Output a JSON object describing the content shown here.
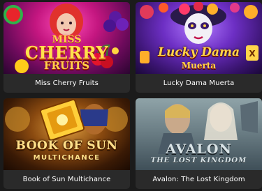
{
  "games": [
    {
      "title": "Miss Cherry Fruits",
      "logo_lines": [
        "MISS",
        "CHERRY",
        "FRUITS"
      ],
      "icon": "cherry-icon"
    },
    {
      "title": "Lucky Dama Muerta",
      "logo_lines": [
        "Lucky Dama",
        "Muerta"
      ],
      "icon": "skull-icon"
    },
    {
      "title": "Book of Sun Multichance",
      "logo_lines": [
        "BOOK OF SUN",
        "MULTICHANCE"
      ],
      "icon": "book-icon"
    },
    {
      "title": "Avalon: The Lost Kingdom",
      "logo_lines": [
        "AVALON",
        "THE LOST KINGDOM"
      ],
      "icon": "knight-icon"
    }
  ],
  "colors": {
    "page_background": "#1b1b1b",
    "card_background": "#2a2a2a",
    "caption_text": "#ffffff"
  }
}
